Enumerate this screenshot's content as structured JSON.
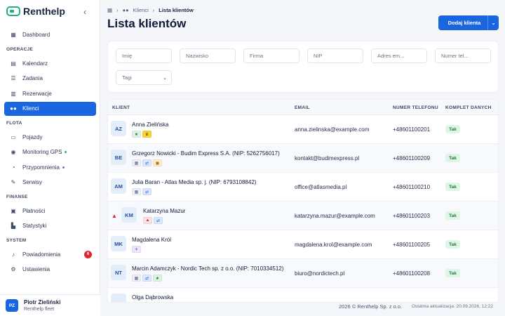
{
  "sidebar": {
    "brand": "Renthelp",
    "items": [
      {
        "label": "Dashboard",
        "icon": "grid-icon"
      },
      {
        "section": "OPERACJE"
      },
      {
        "label": "Kalendarz",
        "icon": "calendar-icon"
      },
      {
        "label": "Zadania",
        "icon": "checklist-icon"
      },
      {
        "label": "Rezerwacje",
        "icon": "bookings-icon"
      },
      {
        "label": "Klienci",
        "icon": "users-icon",
        "active": true
      },
      {
        "section": "FLOTA"
      },
      {
        "label": "Pojazdy",
        "icon": "car-icon"
      },
      {
        "label": "Monitoring GPS",
        "icon": "location-icon",
        "dot": "#1fb57a"
      },
      {
        "label": "Przypomnienia",
        "icon": "alarm-icon",
        "dot": "#8c5cd6"
      },
      {
        "label": "Serwisy",
        "icon": "wrench-icon"
      },
      {
        "section": "FINANSE"
      },
      {
        "label": "Płatności",
        "icon": "wallet-icon"
      },
      {
        "label": "Statystyki",
        "icon": "chart-icon"
      },
      {
        "section": "SYSTEM"
      },
      {
        "label": "Powiadomienia",
        "icon": "bell-icon",
        "badge": "6"
      },
      {
        "label": "Ustawienia",
        "icon": "gear-icon"
      }
    ],
    "user": {
      "initials": "PZ",
      "name": "Piotr Zieliński",
      "org": "Renthelp fleet"
    }
  },
  "header": {
    "breadcrumb": [
      "Klienci",
      "Lista klientów"
    ],
    "title": "Lista klientów",
    "add_button": "Dodaj klienta"
  },
  "filters": {
    "imie": "Imię",
    "nazwisko": "Nazwisko",
    "firma": "Firma",
    "nip": "NIP",
    "email": "Adres em...",
    "phone": "Numer tel...",
    "tags": "Tagi"
  },
  "table": {
    "columns": [
      "KLIENT",
      "EMAIL",
      "NUMER TELEFONU",
      "KOMPLET DANYCH"
    ],
    "rows": [
      {
        "initials": "AZ",
        "name": "Anna Zielińska",
        "email": "anna.zielinska@example.com",
        "phone": "+48601100201",
        "status": "Tak",
        "tags": [
          [
            "★",
            "#dff3e4",
            "#1d7a3e"
          ],
          [
            "♛",
            "#f5d63a",
            "#6b4d00"
          ]
        ]
      },
      {
        "initials": "BE",
        "name": "Grzegorz Nowicki - Budim Express S.A. (NIP: 5262756017)",
        "email": "kontakt@budimexpress.pl",
        "phone": "+48601100209",
        "status": "Tak",
        "tags": [
          [
            "▦",
            "#eef0f5",
            "#5a6480"
          ],
          [
            "⇄",
            "#dbe8fb",
            "#1a66e0"
          ],
          [
            "▣",
            "#fdeccf",
            "#b36a00"
          ]
        ]
      },
      {
        "initials": "AM",
        "name": "Julia Baran - Atlas Media sp. j. (NIP: 6793108842)",
        "email": "office@atlasmedia.pl",
        "phone": "+48601100210",
        "status": "Tak",
        "tags": [
          [
            "▦",
            "#eef0f5",
            "#5a6480"
          ],
          [
            "⇄",
            "#dbe8fb",
            "#1a66e0"
          ]
        ]
      },
      {
        "initials": "KM",
        "name": "Katarzyna Mazur",
        "email": "katarzyna.mazur@example.com",
        "phone": "+48601100203",
        "status": "Tak",
        "warning": true,
        "tags": [
          [
            "▲",
            "#fde2e2",
            "#d8262c"
          ],
          [
            "⇄",
            "#dbe8fb",
            "#1a66e0"
          ]
        ]
      },
      {
        "initials": "MK",
        "name": "Magdalena Król",
        "email": "magdalena.krol@example.com",
        "phone": "+48601100205",
        "status": "Tak",
        "tags": [
          [
            "✈",
            "#efe6fb",
            "#7a44c7"
          ]
        ]
      },
      {
        "initials": "NT",
        "name": "Marcin Adamczyk - Nordic Tech sp. z o.o. (NIP: 7010334512)",
        "email": "biuro@nordictech.pl",
        "phone": "+48601100208",
        "status": "Tak",
        "tags": [
          [
            "▦",
            "#eef0f5",
            "#5a6480"
          ],
          [
            "⇄",
            "#dbe8fb",
            "#1a66e0"
          ],
          [
            "★",
            "#dff3e4",
            "#1d7a3e"
          ]
        ]
      },
      {
        "initials": "",
        "name": "Olga Dąbrowska",
        "email": "",
        "phone": "",
        "status": "",
        "tags": []
      }
    ]
  },
  "footer": {
    "copyright": "2026 © Renthelp Sp. z o.o.",
    "updated": "Ostatnia aktualizacja: 20.09.2026, 12:22"
  }
}
